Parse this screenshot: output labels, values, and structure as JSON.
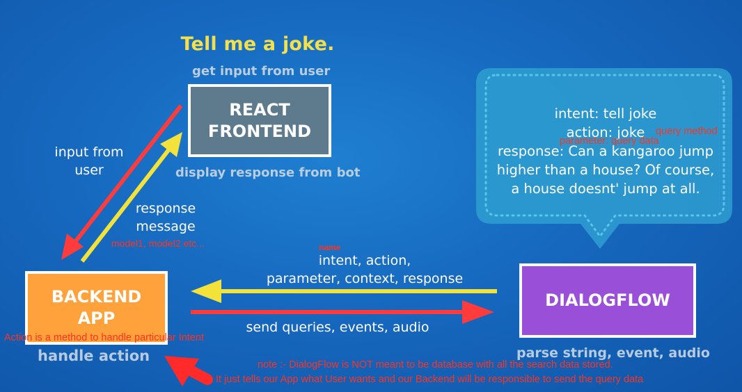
{
  "title": "Tell me a joke.",
  "react": {
    "caption_top": "get input from user",
    "box_line1": "REACT",
    "box_line2": "FRONTEND",
    "caption_bottom": "display response from bot"
  },
  "backend": {
    "box_line1": "BACKEND",
    "box_line2": "APP",
    "caption_bottom": "handle action",
    "note": "Action is a method to handle particular Intent"
  },
  "dialogflow": {
    "box_label": "DIALOGFLOW",
    "caption_bottom": "parse string, event, audio"
  },
  "arrows": {
    "input_line1": "input from",
    "input_line2": "user",
    "response_line1": "response",
    "response_line2": "message",
    "response_note": "model1, model2 etc...",
    "intent_note": "name",
    "intent_line1": "intent, action,",
    "intent_line2": "parameter, context, response",
    "send_label": "send queries, events, audio"
  },
  "bubble": {
    "line1": "intent: tell joke",
    "line2": "action: joke",
    "line3": "response: Can a kangaroo jump",
    "line4": "higher than a house? Of course,",
    "line5": "a house doesnt' jump at all.",
    "note_query_method": "query method",
    "note_parameter": "parameter: query data"
  },
  "footer_note": {
    "line1": "note :- DialogFlow is NOT meant to be database with all the search data stored.",
    "line2": "It just tells our App what User wants and our Backend will be responsible to send the query data"
  },
  "colors": {
    "background": "#1669bf",
    "react_box": "#5e7a8d",
    "backend_box": "#ffa23c",
    "dialogflow_box": "#9a4fd8",
    "bubble": "#2e9fd0",
    "red_arrow": "#ff3b3b",
    "yellow_arrow": "#f2e23a",
    "title": "#f3e04a",
    "annotation": "#ff3322"
  }
}
